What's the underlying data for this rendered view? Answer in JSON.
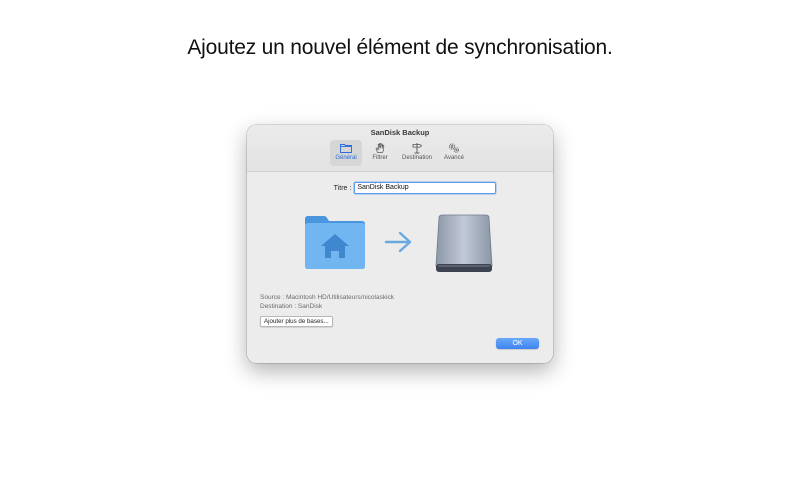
{
  "headline": "Ajoutez un nouvel élément de synchronisation.",
  "window": {
    "title": "SanDisk Backup",
    "toolbar": [
      {
        "label": "Général",
        "icon": "folder-icon",
        "active": true
      },
      {
        "label": "Filtrer",
        "icon": "hand-icon",
        "active": false
      },
      {
        "label": "Destination",
        "icon": "signpost-icon",
        "active": false
      },
      {
        "label": "Avancé",
        "icon": "gears-icon",
        "active": false
      }
    ]
  },
  "form": {
    "title_label": "Titre :",
    "title_value": "SanDisk Backup"
  },
  "icons": {
    "source": "home-folder-icon",
    "arrow": "arrow-right-icon",
    "destination": "external-drive-icon"
  },
  "info": {
    "source": "Source : Macintosh HD/Utilisateurs/nicolaskick",
    "destination": "Destination : SanDisk"
  },
  "buttons": {
    "add_bases": "Ajouter plus de bases...",
    "ok": "OK"
  },
  "colors": {
    "accent": "#3d84f0",
    "folder": "#6fb3f0",
    "arrow": "#6aa8e0"
  }
}
